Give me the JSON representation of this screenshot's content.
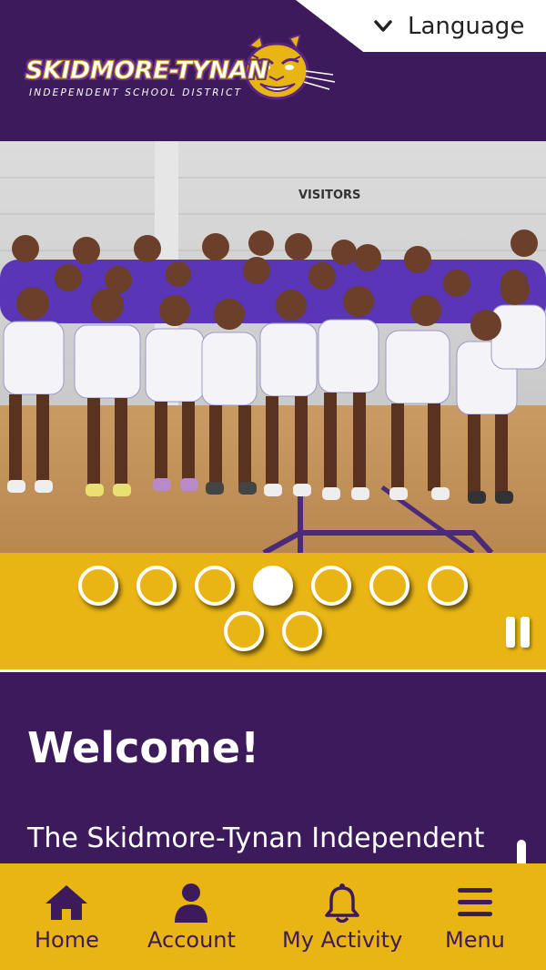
{
  "header": {
    "language_label": "Language",
    "logo": {
      "title": "SKIDMORE-TYNAN",
      "subtitle": "INDEPENDENT SCHOOL DISTRICT"
    }
  },
  "hero": {
    "sign_text": "VISITORS",
    "slide_dots": [
      {
        "active": false
      },
      {
        "active": false
      },
      {
        "active": false
      },
      {
        "active": true
      },
      {
        "active": false
      },
      {
        "active": false
      },
      {
        "active": false
      },
      {
        "active": false
      },
      {
        "active": false
      }
    ],
    "active_slide_index": 3
  },
  "welcome": {
    "title": "Welcome!",
    "body": "The Skidmore-Tynan Independent"
  },
  "bottom_nav": {
    "items": [
      {
        "label": "Home",
        "icon": "home-icon"
      },
      {
        "label": "Account",
        "icon": "person-icon"
      },
      {
        "label": "My Activity",
        "icon": "bell-icon"
      },
      {
        "label": "Menu",
        "icon": "hamburger-menu-icon"
      }
    ]
  },
  "colors": {
    "purple": "#3d1a5c",
    "gold": "#e8b514",
    "white": "#ffffff"
  }
}
